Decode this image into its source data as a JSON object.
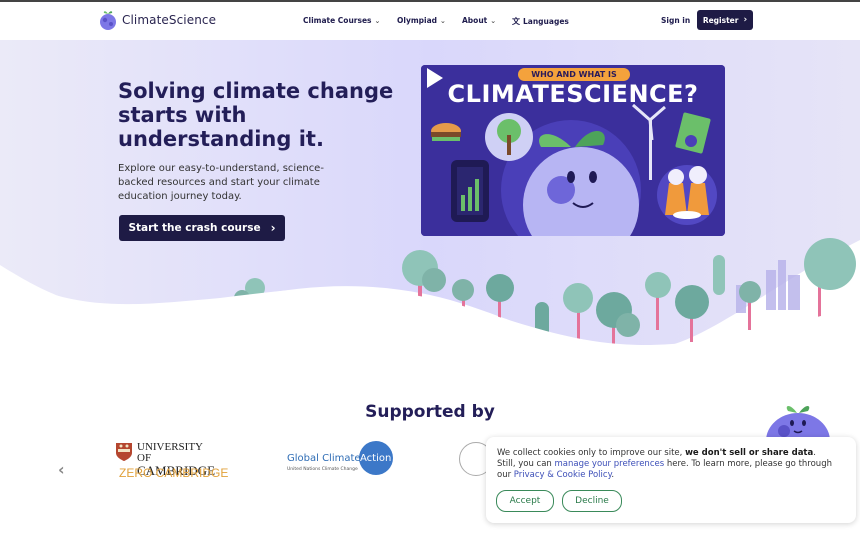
{
  "nav": {
    "brand": "ClimateScience",
    "items": [
      {
        "label": "Climate Courses",
        "chevron": "⌄"
      },
      {
        "label": "Olympiad",
        "chevron": "⌄"
      },
      {
        "label": "About",
        "chevron": "⌄"
      }
    ],
    "languages_label": "Languages",
    "sign_in_label": "Sign in",
    "register_label": "Register"
  },
  "hero": {
    "title": "Solving climate change starts with understanding it.",
    "subtitle": "Explore our easy-to-understand, science-backed resources and start your climate education journey today.",
    "cta_label": "Start the crash course",
    "video_tag": "WHO AND WHAT IS",
    "video_title": "CLIMATESCIENCE?"
  },
  "supported": {
    "title": "Supported by",
    "logos": {
      "cambridge_line1": "UNIVERSITY OF",
      "cambridge_line2": "CAMBRIDGE",
      "cambridge_zero": "ZERO CAMBRIDGE",
      "gca_text": "Global Climate",
      "gca_action": "Action",
      "gca_sub": "United Nations Climate Change"
    }
  },
  "cookie": {
    "text_1": "We collect cookies only to improve our site, ",
    "text_bold": "we don't sell or share data",
    "text_2": ". Still, you can ",
    "link_preferences": "manage your preferences",
    "text_3": " here. To learn more, please go through our ",
    "link_policy": "Privacy & Cookie Policy",
    "text_4": ".",
    "accept_label": "Accept",
    "decline_label": "Decline"
  },
  "colors": {
    "primary_dark": "#1e1b45",
    "hero_bg": "#e4e2fb",
    "accent_green": "#3a8a5a",
    "link_blue": "#3d4fb8"
  },
  "icons": {
    "logo": "globe-mascot-icon",
    "languages": "translate-icon",
    "arrow": "chevron-right-icon",
    "carousel_prev": "chevron-left-icon",
    "play": "play-icon"
  }
}
